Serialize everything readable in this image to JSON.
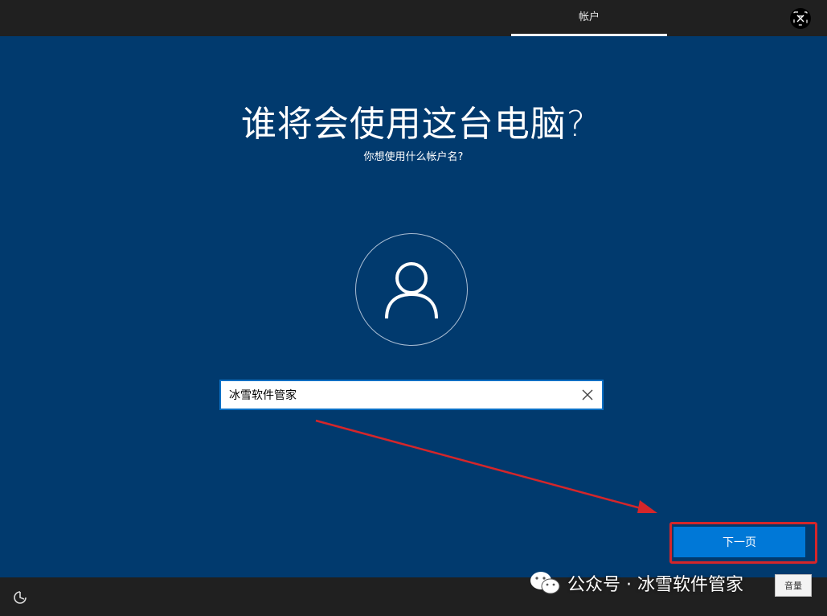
{
  "header": {
    "tab_label": "帐户",
    "language_icon": "translate-icon"
  },
  "main": {
    "title": "谁将会使用这台电脑?",
    "subtitle": "你想使用什么帐户名?",
    "avatar_icon": "user-icon",
    "username_value": "冰雪软件管家",
    "clear_icon": "close-icon",
    "next_label": "下一页"
  },
  "footer": {
    "accessibility_icon": "accessibility-icon",
    "volume_label": "音量"
  },
  "watermark": {
    "icon": "wechat-icon",
    "text": "公众号 · 冰雪软件管家"
  },
  "colors": {
    "background": "#013a6e",
    "topbar": "#202020",
    "primary_button": "#0078d7",
    "highlight": "#d5262a"
  }
}
